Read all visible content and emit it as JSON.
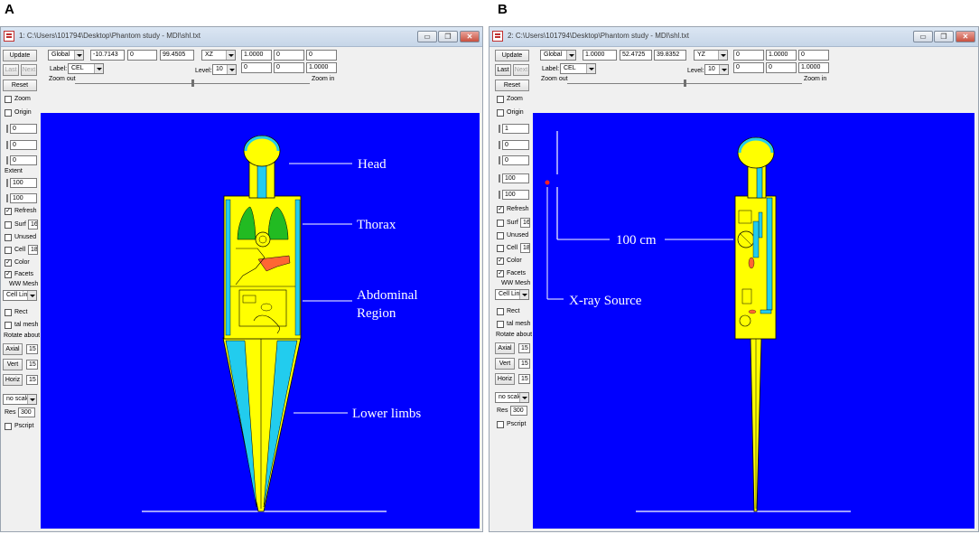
{
  "panels": {
    "a_letter": "A",
    "b_letter": "B"
  },
  "window_a": {
    "title": "1:  C:\\Users\\101794\\Desktop\\Phantom study - MDI\\shl.txt",
    "toolbar": {
      "frame": "Global",
      "coord1": "-10.7143",
      "coord2": "0",
      "coord3": "99.4505",
      "plane": "XZ",
      "v1": "1.0000",
      "v2": "0",
      "v3": "0",
      "label_text": "Label:",
      "label_value": "CEL",
      "level_text": "Level:",
      "level_value": "10",
      "w1": "0",
      "w2": "0",
      "w3": "1.0000",
      "zoom_out": "Zoom out",
      "zoom_in": "Zoom in",
      "zoom_fraction": 0.54
    },
    "left": {
      "update": "Update",
      "last": "Last",
      "next": "Next",
      "reset": "Reset",
      "zoom": "Zoom",
      "origin": "Origin",
      "s1": "0",
      "s2": "0",
      "s3": "0",
      "extent": "Extent",
      "e1": "100",
      "e2": "100",
      "refresh": "Refresh",
      "surf": "Surf",
      "surf_val": "16",
      "unused": "Unused",
      "cell": "Cell",
      "cell_val": "18",
      "color": "Color",
      "facets": "Facets",
      "wwmesh": "WW Mesh",
      "cellline": "Cell Line",
      "rect": "Rect",
      "talmesh": "tal mesh",
      "rotate": "Rotate about",
      "axial": "Axial",
      "axial_val": "15",
      "vert": "Vert",
      "vert_val": "15",
      "horiz": "Horiz",
      "horiz_val": "15",
      "noscale": "no scale",
      "res": "Res",
      "res_val": "300",
      "pscript": "Pscript",
      "refresh_checked": true,
      "color_checked": true,
      "facets_checked": true
    },
    "annotations": {
      "head": "Head",
      "thorax": "Thorax",
      "abdominal_1": "Abdominal",
      "abdominal_2": "Region",
      "lower": "Lower limbs"
    }
  },
  "window_b": {
    "title": "2:  C:\\Users\\101794\\Desktop\\Phantom study - MDI\\shl.txt",
    "toolbar": {
      "frame": "Global",
      "coord1": "1.0000",
      "coord2": "52.4725",
      "coord3": "39.8352",
      "plane": "YZ",
      "v1": "0",
      "v2": "1.0000",
      "v3": "0",
      "label_text": "Label:",
      "label_value": "CEL",
      "level_text": "Level:",
      "level_value": "10",
      "w1": "0",
      "w2": "0",
      "w3": "1.0000",
      "zoom_out": "Zoom out",
      "zoom_in": "Zoom in",
      "zoom_fraction": 0.54
    },
    "left": {
      "update": "Update",
      "last": "Last",
      "next": "Next",
      "reset": "Reset",
      "zoom": "Zoom",
      "origin": "Origin",
      "s1": "1",
      "s2": "0",
      "s3": "0",
      "e1": "100",
      "e2": "100",
      "refresh": "Refresh",
      "surf": "Surf",
      "surf_val": "16",
      "unused": "Unused",
      "cell": "Cell",
      "cell_val": "18",
      "color": "Color",
      "facets": "Facets",
      "wwmesh": "WW Mesh",
      "cellline": "Cell Line",
      "rect": "Rect",
      "talmesh": "tal mesh",
      "rotate": "Rotate about",
      "axial": "Axial",
      "axial_val": "15",
      "vert": "Vert",
      "vert_val": "15",
      "horiz": "Horiz",
      "horiz_val": "15",
      "noscale": "no scale",
      "res": "Res",
      "res_val": "300",
      "pscript": "Pscript",
      "refresh_checked": true,
      "color_checked": true,
      "facets_checked": true
    },
    "annotations": {
      "distance": "100 cm",
      "source": "X-ray Source"
    }
  },
  "window_buttons": {
    "minimize": "▭",
    "restore": "❐",
    "close": "✕"
  },
  "colors": {
    "view_bg": "#0000ff",
    "phantom_body": "#ffff00",
    "bone_cyan": "#22ccee",
    "lung_green": "#22bb22",
    "organ_orange": "#ff6633",
    "source_dot": "#ff2020"
  }
}
